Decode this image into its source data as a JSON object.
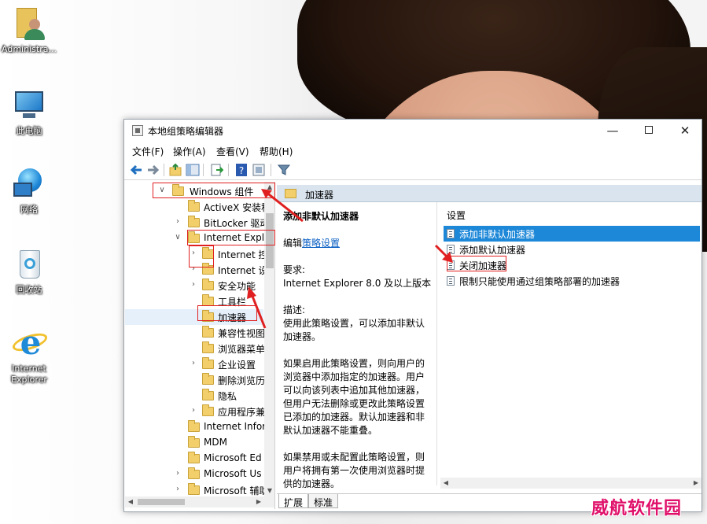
{
  "desktop": {
    "icons": [
      {
        "label": "Administra..."
      },
      {
        "label": "此电脑"
      },
      {
        "label": "网络"
      },
      {
        "label": "回收站"
      },
      {
        "label": "Internet Explorer"
      }
    ]
  },
  "window": {
    "title": "本地组策略编辑器",
    "controls": {
      "minimize": "—",
      "close": "✕"
    }
  },
  "menu": [
    "文件(F)",
    "操作(A)",
    "查看(V)",
    "帮助(H)"
  ],
  "tree": {
    "items": [
      {
        "label": "Windows 组件",
        "expander": "∨",
        "indent": 0
      },
      {
        "label": "ActiveX 安装程",
        "expander": "",
        "indent": 1
      },
      {
        "label": "BitLocker 驱动",
        "expander": "›",
        "indent": 1
      },
      {
        "label": "Internet Explo",
        "expander": "∨",
        "indent": 1
      },
      {
        "label": "Internet 控",
        "expander": "›",
        "indent": 2
      },
      {
        "label": "Internet 设",
        "expander": "›",
        "indent": 2
      },
      {
        "label": "安全功能",
        "expander": "›",
        "indent": 2
      },
      {
        "label": "工具栏",
        "expander": "",
        "indent": 2
      },
      {
        "label": "加速器",
        "expander": "",
        "indent": 2
      },
      {
        "label": "兼容性视图",
        "expander": "",
        "indent": 2
      },
      {
        "label": "浏览器菜单",
        "expander": "",
        "indent": 2
      },
      {
        "label": "企业设置",
        "expander": "›",
        "indent": 2
      },
      {
        "label": "删除浏览历",
        "expander": "",
        "indent": 2
      },
      {
        "label": "隐私",
        "expander": "",
        "indent": 2
      },
      {
        "label": "应用程序兼",
        "expander": "›",
        "indent": 2
      },
      {
        "label": "Internet Infor",
        "expander": "",
        "indent": 1
      },
      {
        "label": "MDM",
        "expander": "",
        "indent": 1
      },
      {
        "label": "Microsoft Ed",
        "expander": "",
        "indent": 1
      },
      {
        "label": "Microsoft Us",
        "expander": "›",
        "indent": 1
      },
      {
        "label": "Microsoft 辅助",
        "expander": "›",
        "indent": 1
      }
    ]
  },
  "pane": {
    "header": "加速器",
    "description": {
      "title": "添加非默认加速器",
      "edit_prefix": "编辑",
      "edit_link": "策略设置",
      "req_label": "要求:",
      "req_text": "Internet Explorer 8.0 及以上版本",
      "desc_label": "描述:",
      "desc_text": "使用此策略设置，可以添加非默认加速器。",
      "enabled_text": "如果启用此策略设置，则向用户的浏览器中添加指定的加速器。用户可以向该列表中追加其他加速器，但用户无法删除或更改此策略设置已添加的加速器。默认加速器和非默认加速器不能重叠。",
      "disabled_text": "如果禁用或未配置此策略设置，则用户将拥有第一次使用浏览器时提供的加速器。"
    },
    "list_header": "设置",
    "settings": [
      {
        "label": "添加非默认加速器",
        "selected": true
      },
      {
        "label": "添加默认加速器",
        "selected": false
      },
      {
        "label": "关闭加速器",
        "selected": false
      },
      {
        "label": "限制只能使用通过组策略部署的加速器",
        "selected": false
      }
    ],
    "tabs": [
      "扩展",
      "标准"
    ]
  },
  "watermark": "威航软件园",
  "colors": {
    "selection": "#1e88d8",
    "annotation": "#e02020",
    "watermark": "#e0106a"
  }
}
